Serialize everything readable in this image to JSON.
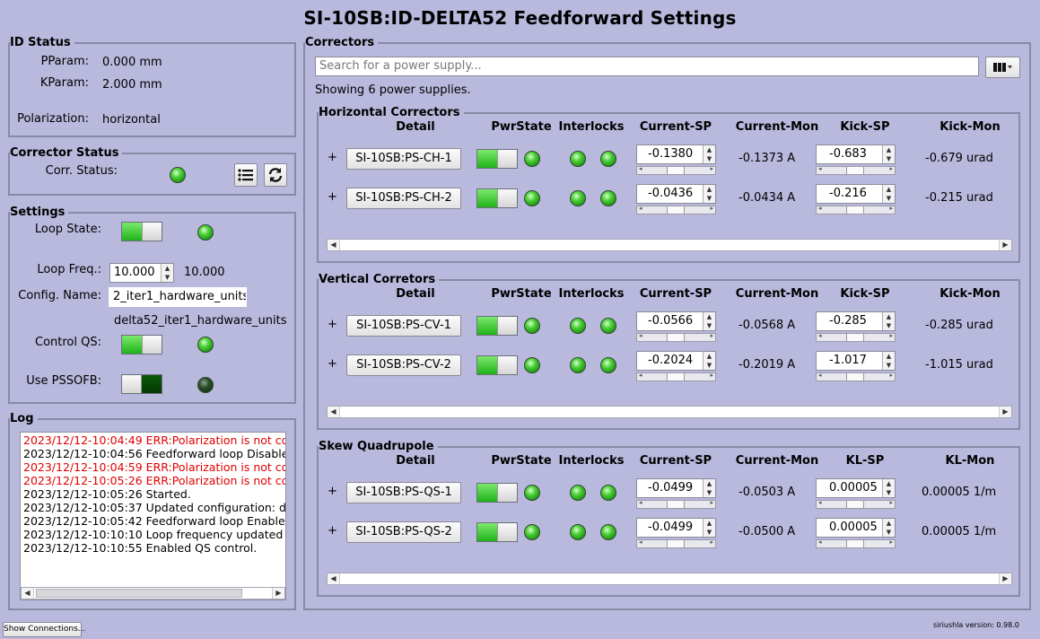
{
  "window_title": "SI-10SB:ID-DELTA52 Feedforward Settings",
  "id_status": {
    "title": "ID Status",
    "pparam_label": "PParam:",
    "pparam_value": "0.000 mm",
    "kparam_label": "KParam:",
    "kparam_value": "2.000 mm",
    "polarization_label": "Polarization:",
    "polarization_value": "horizontal"
  },
  "corrector_status": {
    "title": "Corrector Status",
    "label": "Corr. Status:"
  },
  "settings": {
    "title": "Settings",
    "loop_state_label": "Loop State:",
    "loop_freq_label": "Loop Freq.:",
    "loop_freq_sp": "10.000",
    "loop_freq_mon": "10.000",
    "config_name_label": "Config. Name:",
    "config_name_value": "2_iter1_hardware_units",
    "config_name_mon": "delta52_iter1_hardware_units",
    "control_qs_label": "Control QS:",
    "use_pssofb_label": "Use PSSOFB:"
  },
  "log": {
    "title": "Log",
    "lines": [
      {
        "text": "2023/12/12-10:04:49 ERR:Polarization is not co",
        "err": true
      },
      {
        "text": "2023/12/12-10:04:56 Feedforward loop Disable",
        "err": false
      },
      {
        "text": "2023/12/12-10:04:59 ERR:Polarization is not co",
        "err": true
      },
      {
        "text": "2023/12/12-10:05:26 ERR:Polarization is not co",
        "err": true
      },
      {
        "text": "2023/12/12-10:05:26 Started.",
        "err": false
      },
      {
        "text": "2023/12/12-10:05:37 Updated configuration: d",
        "err": false
      },
      {
        "text": "2023/12/12-10:05:42 Feedforward loop Enable",
        "err": false
      },
      {
        "text": "2023/12/12-10:10:10 Loop frequency updated",
        "err": false
      },
      {
        "text": "2023/12/12-10:10:55 Enabled QS control.",
        "err": false
      }
    ]
  },
  "correctors": {
    "title": "Correctors",
    "search_placeholder": "Search for a power supply...",
    "showing_text": "Showing 6 power supplies.",
    "groups": [
      {
        "title": "Horizontal Correctors",
        "headers": [
          "Detail",
          "PwrState",
          "Interlocks",
          "Current-SP",
          "Current-Mon",
          "Kick-SP",
          "Kick-Mon"
        ],
        "rows": [
          {
            "name": "SI-10SB:PS-CH-1",
            "current_sp": "-0.1380",
            "current_mon": "-0.1373 A",
            "kick_sp": "-0.683",
            "kick_mon": "-0.679 urad"
          },
          {
            "name": "SI-10SB:PS-CH-2",
            "current_sp": "-0.0436",
            "current_mon": "-0.0434 A",
            "kick_sp": "-0.216",
            "kick_mon": "-0.215 urad"
          }
        ]
      },
      {
        "title": "Vertical Corretors",
        "headers": [
          "Detail",
          "PwrState",
          "Interlocks",
          "Current-SP",
          "Current-Mon",
          "Kick-SP",
          "Kick-Mon"
        ],
        "rows": [
          {
            "name": "SI-10SB:PS-CV-1",
            "current_sp": "-0.0566",
            "current_mon": "-0.0568 A",
            "kick_sp": "-0.285",
            "kick_mon": "-0.285 urad"
          },
          {
            "name": "SI-10SB:PS-CV-2",
            "current_sp": "-0.2024",
            "current_mon": "-0.2019 A",
            "kick_sp": "-1.017",
            "kick_mon": "-1.015 urad"
          }
        ]
      },
      {
        "title": "Skew Quadrupole",
        "headers": [
          "Detail",
          "PwrState",
          "Interlocks",
          "Current-SP",
          "Current-Mon",
          "KL-SP",
          "KL-Mon"
        ],
        "rows": [
          {
            "name": "SI-10SB:PS-QS-1",
            "current_sp": "-0.0499",
            "current_mon": "-0.0503 A",
            "kick_sp": "0.00005",
            "kick_mon": "0.00005 1/m"
          },
          {
            "name": "SI-10SB:PS-QS-2",
            "current_sp": "-0.0499",
            "current_mon": "-0.0500 A",
            "kick_sp": "0.00005",
            "kick_mon": "0.00005 1/m"
          }
        ]
      }
    ]
  },
  "footer": {
    "show_connections": "Show Connections...",
    "version": "siriushla version: 0.98.0"
  },
  "colors": {
    "background": "#b9b8dd",
    "led_on": "#1fb31a",
    "led_off": "#0d2a0c",
    "error_text": "#e00000"
  }
}
